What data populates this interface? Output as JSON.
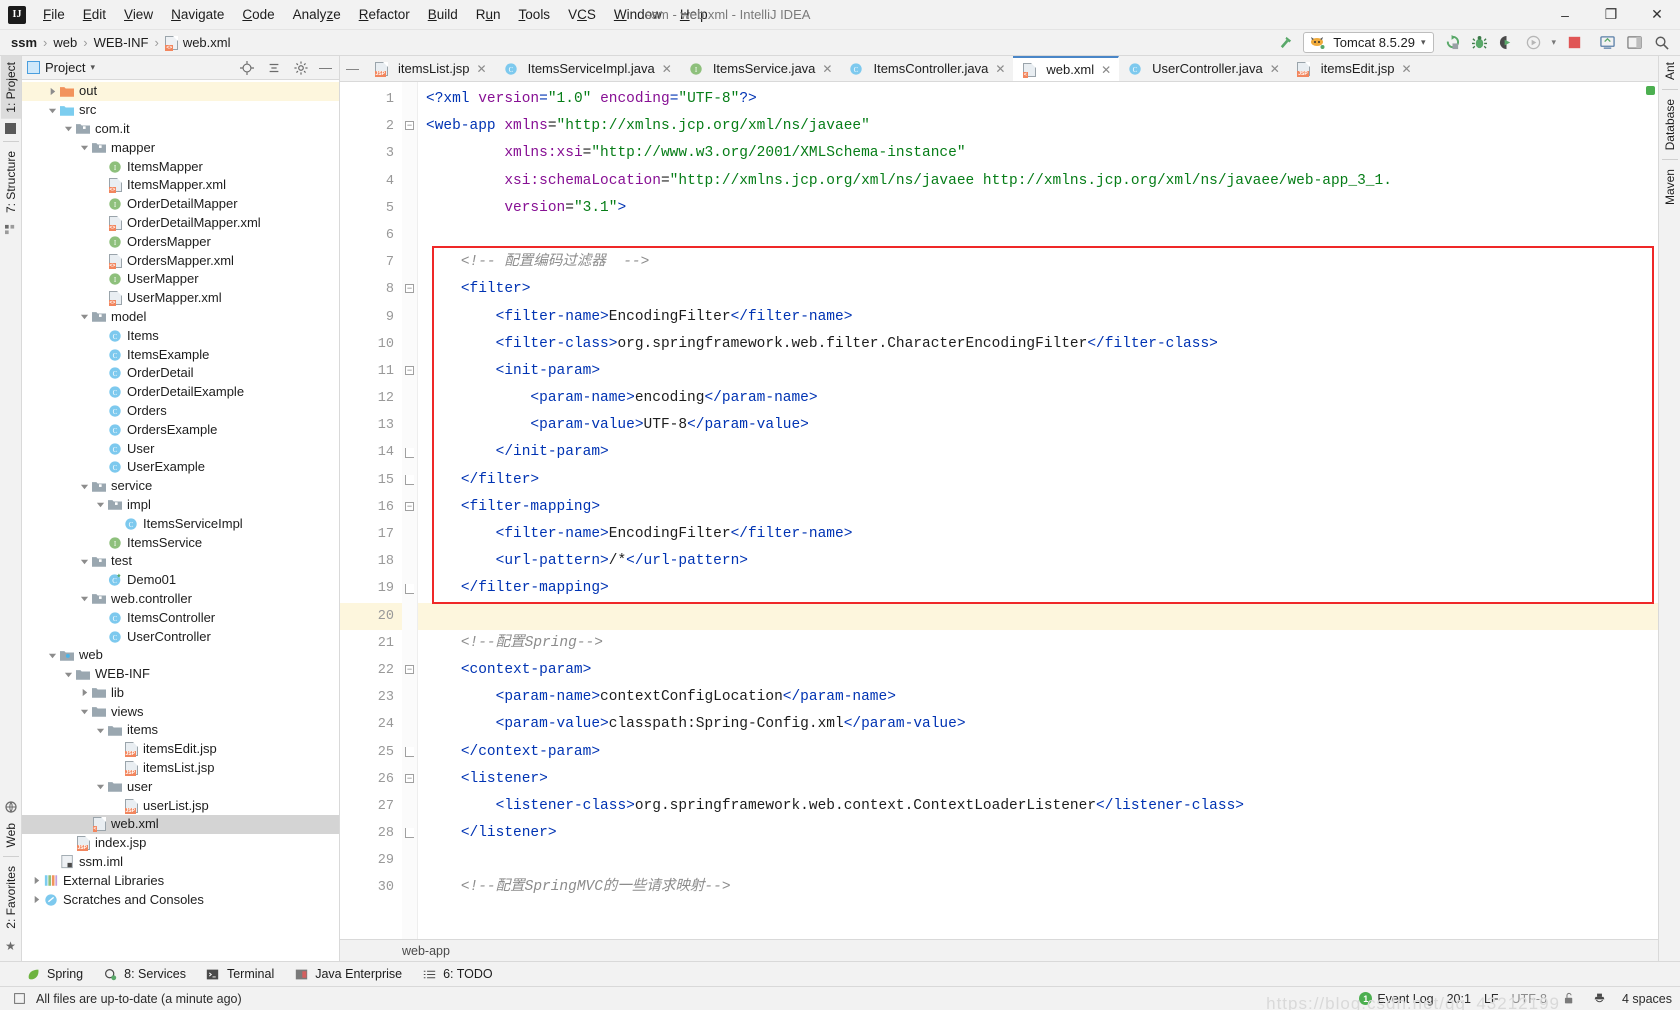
{
  "window": {
    "title": "ssm - web.xml - IntelliJ IDEA",
    "logo": "intellij-idea-logo",
    "minimize": "–",
    "maximize": "❐",
    "close": "✕"
  },
  "menubar": {
    "items": [
      {
        "label": "File"
      },
      {
        "label": "Edit"
      },
      {
        "label": "View"
      },
      {
        "label": "Navigate"
      },
      {
        "label": "Code"
      },
      {
        "label": "Analyze"
      },
      {
        "label": "Refactor"
      },
      {
        "label": "Build"
      },
      {
        "label": "Run"
      },
      {
        "label": "Tools"
      },
      {
        "label": "VCS"
      },
      {
        "label": "Window"
      },
      {
        "label": "Help"
      }
    ]
  },
  "breadcrumb": {
    "items": [
      "ssm",
      "web",
      "WEB-INF",
      "web.xml"
    ],
    "separator": "›"
  },
  "toolbar": {
    "hammer_icon": "build-hammer-icon",
    "run_config": {
      "label": "Tomcat 8.5.29",
      "icon": "tomcat-icon",
      "arrow": "▾"
    },
    "rerun_icon": "rerun-icon",
    "debug_icon": "debug-icon",
    "coverage_icon": "run-with-coverage-icon",
    "profile_icon": "profile-icon",
    "profile_arrow": "▾",
    "stop_icon": "stop-icon",
    "updates_icon": "update-running-application-icon",
    "layout_icon": "layout-icon",
    "search_icon": "search-everywhere-icon"
  },
  "left_strip": {
    "tabs": [
      "1: Project",
      "7: Structure"
    ],
    "bottom_tabs": [
      "Web",
      "2: Favorites"
    ]
  },
  "right_strip": {
    "tabs": [
      "Ant",
      "Database",
      "Maven"
    ]
  },
  "project_panel": {
    "title": "Project",
    "title_arrow": "▾",
    "locate_icon": "locate-icon",
    "collapse_icon": "collapse-all-icon",
    "settings_icon": "gear-icon",
    "hide_icon": "hide-icon",
    "tree": [
      {
        "label": "out",
        "depth": 1,
        "twist": "collapsed",
        "icon": "folder-orange",
        "state": "highlight"
      },
      {
        "label": "src",
        "depth": 1,
        "twist": "expanded",
        "icon": "folder-blue"
      },
      {
        "label": "com.it",
        "depth": 2,
        "twist": "expanded",
        "icon": "package"
      },
      {
        "label": "mapper",
        "depth": 3,
        "twist": "expanded",
        "icon": "package"
      },
      {
        "label": "ItemsMapper",
        "depth": 4,
        "twist": "none",
        "icon": "interface"
      },
      {
        "label": "ItemsMapper.xml",
        "depth": 4,
        "twist": "none",
        "icon": "xml"
      },
      {
        "label": "OrderDetailMapper",
        "depth": 4,
        "twist": "none",
        "icon": "interface"
      },
      {
        "label": "OrderDetailMapper.xml",
        "depth": 4,
        "twist": "none",
        "icon": "xml"
      },
      {
        "label": "OrdersMapper",
        "depth": 4,
        "twist": "none",
        "icon": "interface"
      },
      {
        "label": "OrdersMapper.xml",
        "depth": 4,
        "twist": "none",
        "icon": "xml"
      },
      {
        "label": "UserMapper",
        "depth": 4,
        "twist": "none",
        "icon": "interface"
      },
      {
        "label": "UserMapper.xml",
        "depth": 4,
        "twist": "none",
        "icon": "xml"
      },
      {
        "label": "model",
        "depth": 3,
        "twist": "expanded",
        "icon": "package"
      },
      {
        "label": "Items",
        "depth": 4,
        "twist": "none",
        "icon": "class"
      },
      {
        "label": "ItemsExample",
        "depth": 4,
        "twist": "none",
        "icon": "class"
      },
      {
        "label": "OrderDetail",
        "depth": 4,
        "twist": "none",
        "icon": "class"
      },
      {
        "label": "OrderDetailExample",
        "depth": 4,
        "twist": "none",
        "icon": "class"
      },
      {
        "label": "Orders",
        "depth": 4,
        "twist": "none",
        "icon": "class"
      },
      {
        "label": "OrdersExample",
        "depth": 4,
        "twist": "none",
        "icon": "class"
      },
      {
        "label": "User",
        "depth": 4,
        "twist": "none",
        "icon": "class"
      },
      {
        "label": "UserExample",
        "depth": 4,
        "twist": "none",
        "icon": "class"
      },
      {
        "label": "service",
        "depth": 3,
        "twist": "expanded",
        "icon": "package"
      },
      {
        "label": "impl",
        "depth": 4,
        "twist": "expanded",
        "icon": "package"
      },
      {
        "label": "ItemsServiceImpl",
        "depth": 5,
        "twist": "none",
        "icon": "class"
      },
      {
        "label": "ItemsService",
        "depth": 4,
        "twist": "none",
        "icon": "interface"
      },
      {
        "label": "test",
        "depth": 3,
        "twist": "expanded",
        "icon": "package"
      },
      {
        "label": "Demo01",
        "depth": 4,
        "twist": "none",
        "icon": "test-class"
      },
      {
        "label": "web.controller",
        "depth": 3,
        "twist": "expanded",
        "icon": "package"
      },
      {
        "label": "ItemsController",
        "depth": 4,
        "twist": "none",
        "icon": "class"
      },
      {
        "label": "UserController",
        "depth": 4,
        "twist": "none",
        "icon": "class"
      },
      {
        "label": "web",
        "depth": 1,
        "twist": "expanded",
        "icon": "web-folder"
      },
      {
        "label": "WEB-INF",
        "depth": 2,
        "twist": "expanded",
        "icon": "folder-gray"
      },
      {
        "label": "lib",
        "depth": 3,
        "twist": "collapsed",
        "icon": "folder-gray"
      },
      {
        "label": "views",
        "depth": 3,
        "twist": "expanded",
        "icon": "folder-gray"
      },
      {
        "label": "items",
        "depth": 4,
        "twist": "expanded",
        "icon": "folder-gray"
      },
      {
        "label": "itemsEdit.jsp",
        "depth": 5,
        "twist": "none",
        "icon": "jsp"
      },
      {
        "label": "itemsList.jsp",
        "depth": 5,
        "twist": "none",
        "icon": "jsp"
      },
      {
        "label": "user",
        "depth": 4,
        "twist": "expanded",
        "icon": "folder-gray"
      },
      {
        "label": "userList.jsp",
        "depth": 5,
        "twist": "none",
        "icon": "jsp"
      },
      {
        "label": "web.xml",
        "depth": 3,
        "twist": "none",
        "icon": "webxml",
        "state": "selected"
      },
      {
        "label": "index.jsp",
        "depth": 2,
        "twist": "none",
        "icon": "jsp"
      },
      {
        "label": "ssm.iml",
        "depth": 1,
        "twist": "none",
        "icon": "iml"
      },
      {
        "label": "External Libraries",
        "depth": 0,
        "twist": "collapsed",
        "icon": "libraries"
      },
      {
        "label": "Scratches and Consoles",
        "depth": 0,
        "twist": "collapsed",
        "icon": "scratches"
      }
    ]
  },
  "editor": {
    "tabs": [
      {
        "label": "itemsList.jsp",
        "icon": "jsp",
        "active": false
      },
      {
        "label": "ItemsServiceImpl.java",
        "icon": "class",
        "active": false
      },
      {
        "label": "ItemsService.java",
        "icon": "interface",
        "active": false
      },
      {
        "label": "ItemsController.java",
        "icon": "class",
        "active": false
      },
      {
        "label": "web.xml",
        "icon": "webxml",
        "active": true
      },
      {
        "label": "UserController.java",
        "icon": "class",
        "active": false
      },
      {
        "label": "itemsEdit.jsp",
        "icon": "jsp",
        "active": false
      }
    ],
    "tab_close": "✕",
    "current_line": 20,
    "breadcrumb": "web-app",
    "first_line": 1,
    "lines": [
      {
        "n": 1,
        "fold": "",
        "tokens": [
          {
            "t": "pi",
            "v": "<?xml "
          },
          {
            "t": "attr",
            "v": "version"
          },
          {
            "t": "pi",
            "v": "="
          },
          {
            "t": "val",
            "v": "\"1.0\""
          },
          {
            "t": "pi",
            "v": " "
          },
          {
            "t": "attr",
            "v": "encoding"
          },
          {
            "t": "pi",
            "v": "="
          },
          {
            "t": "val",
            "v": "\"UTF-8\""
          },
          {
            "t": "pi",
            "v": "?>"
          }
        ]
      },
      {
        "n": 2,
        "fold": "minus",
        "tokens": [
          {
            "t": "tag",
            "v": "<web-app "
          },
          {
            "t": "attr",
            "v": "xmlns"
          },
          {
            "t": "txt",
            "v": "="
          },
          {
            "t": "val",
            "v": "\"http://xmlns.jcp.org/xml/ns/javaee\""
          }
        ]
      },
      {
        "n": 3,
        "fold": "",
        "tokens": [
          {
            "t": "txt",
            "v": "         "
          },
          {
            "t": "attr",
            "v": "xmlns:xsi"
          },
          {
            "t": "txt",
            "v": "="
          },
          {
            "t": "val",
            "v": "\"http://www.w3.org/2001/XMLSchema-instance\""
          }
        ]
      },
      {
        "n": 4,
        "fold": "",
        "tokens": [
          {
            "t": "txt",
            "v": "         "
          },
          {
            "t": "attr",
            "v": "xsi:schemaLocation"
          },
          {
            "t": "txt",
            "v": "="
          },
          {
            "t": "val",
            "v": "\"http://xmlns.jcp.org/xml/ns/javaee http://xmlns.jcp.org/xml/ns/javaee/web-app_3_1."
          }
        ]
      },
      {
        "n": 5,
        "fold": "",
        "tokens": [
          {
            "t": "txt",
            "v": "         "
          },
          {
            "t": "attr",
            "v": "version"
          },
          {
            "t": "txt",
            "v": "="
          },
          {
            "t": "val",
            "v": "\"3.1\""
          },
          {
            "t": "tag",
            "v": ">"
          }
        ]
      },
      {
        "n": 6,
        "fold": "",
        "tokens": []
      },
      {
        "n": 7,
        "fold": "",
        "tokens": [
          {
            "t": "txt",
            "v": "    "
          },
          {
            "t": "cmt",
            "v": "<!-- 配置编码过滤器  -->"
          }
        ]
      },
      {
        "n": 8,
        "fold": "minus",
        "tokens": [
          {
            "t": "txt",
            "v": "    "
          },
          {
            "t": "tag",
            "v": "<filter>"
          }
        ]
      },
      {
        "n": 9,
        "fold": "",
        "tokens": [
          {
            "t": "txt",
            "v": "        "
          },
          {
            "t": "tag",
            "v": "<filter-name>"
          },
          {
            "t": "txt",
            "v": "EncodingFilter"
          },
          {
            "t": "tag",
            "v": "</filter-name>"
          }
        ]
      },
      {
        "n": 10,
        "fold": "",
        "tokens": [
          {
            "t": "txt",
            "v": "        "
          },
          {
            "t": "tag",
            "v": "<filter-class>"
          },
          {
            "t": "txt",
            "v": "org.springframework.web.filter.CharacterEncodingFilter"
          },
          {
            "t": "tag",
            "v": "</filter-class>"
          }
        ]
      },
      {
        "n": 11,
        "fold": "minus",
        "tokens": [
          {
            "t": "txt",
            "v": "        "
          },
          {
            "t": "tag",
            "v": "<init-param>"
          }
        ]
      },
      {
        "n": 12,
        "fold": "",
        "tokens": [
          {
            "t": "txt",
            "v": "            "
          },
          {
            "t": "tag",
            "v": "<param-name>"
          },
          {
            "t": "txt",
            "v": "encoding"
          },
          {
            "t": "tag",
            "v": "</param-name>"
          }
        ]
      },
      {
        "n": 13,
        "fold": "",
        "tokens": [
          {
            "t": "txt",
            "v": "            "
          },
          {
            "t": "tag",
            "v": "<param-value>"
          },
          {
            "t": "txt",
            "v": "UTF-8"
          },
          {
            "t": "tag",
            "v": "</param-value>"
          }
        ]
      },
      {
        "n": 14,
        "fold": "end",
        "tokens": [
          {
            "t": "txt",
            "v": "        "
          },
          {
            "t": "tag",
            "v": "</init-param>"
          }
        ]
      },
      {
        "n": 15,
        "fold": "end",
        "tokens": [
          {
            "t": "txt",
            "v": "    "
          },
          {
            "t": "tag",
            "v": "</filter>"
          }
        ]
      },
      {
        "n": 16,
        "fold": "minus",
        "tokens": [
          {
            "t": "txt",
            "v": "    "
          },
          {
            "t": "tag",
            "v": "<filter-mapping>"
          }
        ]
      },
      {
        "n": 17,
        "fold": "",
        "tokens": [
          {
            "t": "txt",
            "v": "        "
          },
          {
            "t": "tag",
            "v": "<filter-name>"
          },
          {
            "t": "txt",
            "v": "EncodingFilter"
          },
          {
            "t": "tag",
            "v": "</filter-name>"
          }
        ]
      },
      {
        "n": 18,
        "fold": "",
        "tokens": [
          {
            "t": "txt",
            "v": "        "
          },
          {
            "t": "tag",
            "v": "<url-pattern>"
          },
          {
            "t": "txt",
            "v": "/*"
          },
          {
            "t": "tag",
            "v": "</url-pattern>"
          }
        ]
      },
      {
        "n": 19,
        "fold": "end",
        "tokens": [
          {
            "t": "txt",
            "v": "    "
          },
          {
            "t": "tag",
            "v": "</filter-mapping>"
          }
        ]
      },
      {
        "n": 20,
        "fold": "",
        "tokens": [],
        "current": true
      },
      {
        "n": 21,
        "fold": "",
        "tokens": [
          {
            "t": "txt",
            "v": "    "
          },
          {
            "t": "cmt",
            "v": "<!--配置Spring-->"
          }
        ]
      },
      {
        "n": 22,
        "fold": "minus",
        "tokens": [
          {
            "t": "txt",
            "v": "    "
          },
          {
            "t": "tag",
            "v": "<context-param>"
          }
        ]
      },
      {
        "n": 23,
        "fold": "",
        "tokens": [
          {
            "t": "txt",
            "v": "        "
          },
          {
            "t": "tag",
            "v": "<param-name>"
          },
          {
            "t": "txt",
            "v": "contextConfigLocation"
          },
          {
            "t": "tag",
            "v": "</param-name>"
          }
        ]
      },
      {
        "n": 24,
        "fold": "",
        "tokens": [
          {
            "t": "txt",
            "v": "        "
          },
          {
            "t": "tag",
            "v": "<param-value>"
          },
          {
            "t": "txt",
            "v": "classpath:Spring-Config.xml"
          },
          {
            "t": "tag",
            "v": "</param-value>"
          }
        ]
      },
      {
        "n": 25,
        "fold": "end",
        "tokens": [
          {
            "t": "txt",
            "v": "    "
          },
          {
            "t": "tag",
            "v": "</context-param>"
          }
        ]
      },
      {
        "n": 26,
        "fold": "minus",
        "tokens": [
          {
            "t": "txt",
            "v": "    "
          },
          {
            "t": "tag",
            "v": "<listener>"
          }
        ]
      },
      {
        "n": 27,
        "fold": "",
        "tokens": [
          {
            "t": "txt",
            "v": "        "
          },
          {
            "t": "tag",
            "v": "<listener-class>"
          },
          {
            "t": "txt",
            "v": "org.springframework.web.context.ContextLoaderListener"
          },
          {
            "t": "tag",
            "v": "</listener-class>"
          }
        ]
      },
      {
        "n": 28,
        "fold": "end",
        "tokens": [
          {
            "t": "txt",
            "v": "    "
          },
          {
            "t": "tag",
            "v": "</listener>"
          }
        ]
      },
      {
        "n": 29,
        "fold": "",
        "tokens": []
      },
      {
        "n": 30,
        "fold": "",
        "tokens": [
          {
            "t": "txt",
            "v": "    "
          },
          {
            "t": "cmt",
            "v": "<!--配置SpringMVC的一些请求映射-->"
          }
        ]
      }
    ],
    "annotation": {
      "type": "red-rectangle",
      "from_line": 7,
      "to_line": 19
    }
  },
  "bottom_bar": {
    "items": [
      {
        "label": "Spring",
        "icon": "spring-leaf-icon"
      },
      {
        "label": "8: Services",
        "icon": "services-icon"
      },
      {
        "label": "Terminal",
        "icon": "terminal-icon"
      },
      {
        "label": "Java Enterprise",
        "icon": "java-enterprise-icon"
      },
      {
        "label": "6: TODO",
        "icon": "todo-icon"
      }
    ]
  },
  "statusbar": {
    "message": "All files are up-to-date (a minute ago)",
    "message_icon": "document-icon",
    "event_log": {
      "label": "Event Log",
      "count": "1"
    },
    "caret": "20:1",
    "line_separator": "LF",
    "encoding": "UTF-8",
    "lock_icon": "unlocked-icon",
    "inspection_icon": "hector-icon",
    "indent": "4 spaces",
    "watermark": "https://blog.csdn.net/qq_43212199"
  },
  "colors": {
    "accent_blue": "#4a86c7",
    "tag_blue": "#0033b3",
    "attr_purple": "#871094",
    "value_green": "#067d17",
    "comment_gray": "#8c8c8c",
    "annotation_red": "#ef2828",
    "selection_gray": "#d4d4d4",
    "caret_row": "#fdf6dd"
  }
}
